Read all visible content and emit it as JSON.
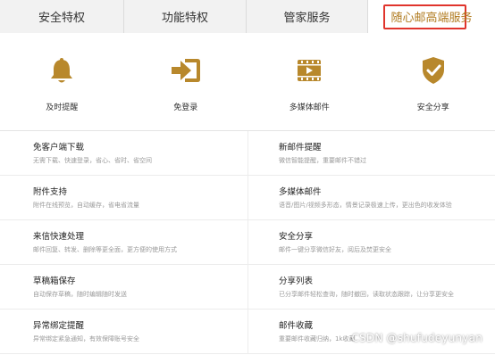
{
  "tabs": [
    {
      "label": "安全特权"
    },
    {
      "label": "功能特权"
    },
    {
      "label": "管家服务"
    },
    {
      "label": "随心邮高端服务"
    }
  ],
  "features": [
    {
      "icon": "bell-icon",
      "label": "及时提醒"
    },
    {
      "icon": "login-icon",
      "label": "免登录"
    },
    {
      "icon": "media-icon",
      "label": "多媒体邮件"
    },
    {
      "icon": "shield-check-icon",
      "label": "安全分享"
    }
  ],
  "rows": [
    {
      "left": {
        "title": "免客户端下载",
        "desc": "无需下载、快速登录，省心、省时、省空间"
      },
      "right": {
        "title": "新邮件提醒",
        "desc": "微信智能提醒，重要邮件不错过"
      }
    },
    {
      "left": {
        "title": "附件支持",
        "desc": "附件在线预览，自动缓存，省电省流量"
      },
      "right": {
        "title": "多媒体邮件",
        "desc": "语音/图片/视频多形态，情景记录极速上传，更出色的收发体验"
      }
    },
    {
      "left": {
        "title": "来信快速处理",
        "desc": "邮件回复、转发、删除等更全面，更方便的使用方式"
      },
      "right": {
        "title": "安全分享",
        "desc": "邮件一键分享微信好友，阅后及焚更安全"
      }
    },
    {
      "left": {
        "title": "草稿箱保存",
        "desc": "自动保存草稿，随时编辑随时发送"
      },
      "right": {
        "title": "分享列表",
        "desc": "已分享邮件轻松查询，随时撤回，读取状态跟踪，让分享更安全"
      }
    },
    {
      "left": {
        "title": "异常绑定提醒",
        "desc": "异常绑定紧急通知，有效保障账号安全"
      },
      "right": {
        "title": "邮件收藏",
        "desc": "重要邮件收藏归纳，1k收藏"
      }
    }
  ],
  "watermark": "CSDN @shufudeyunyan",
  "colors": {
    "accent": "#b8882c",
    "highlight_box": "#e0342c"
  }
}
